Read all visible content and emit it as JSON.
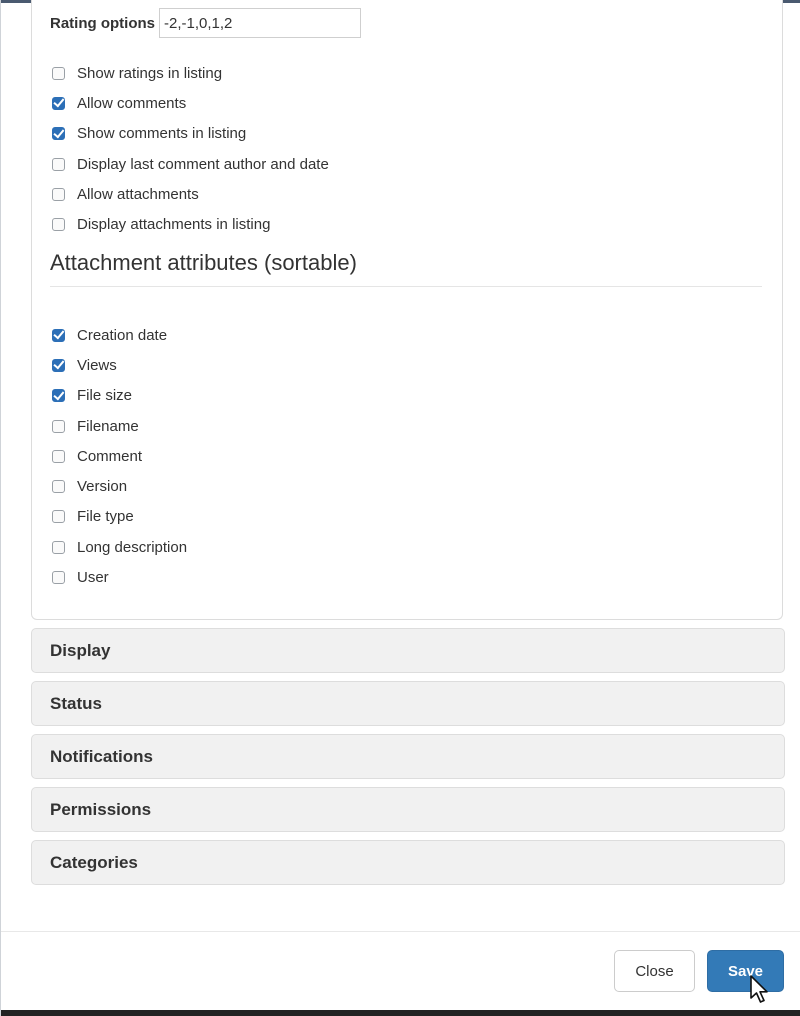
{
  "rating": {
    "label": "Rating options",
    "value": "-2,-1,0,1,2"
  },
  "general_options": [
    {
      "label": "Show ratings in listing",
      "checked": false
    },
    {
      "label": "Allow comments",
      "checked": true
    },
    {
      "label": "Show comments in listing",
      "checked": true
    },
    {
      "label": "Display last comment author and date",
      "checked": false
    },
    {
      "label": "Allow attachments",
      "checked": false
    },
    {
      "label": "Display attachments in listing",
      "checked": false
    }
  ],
  "attachment_section": {
    "heading": "Attachment attributes (sortable)",
    "attributes": [
      {
        "label": "Creation date",
        "checked": true
      },
      {
        "label": "Views",
        "checked": true
      },
      {
        "label": "File size",
        "checked": true
      },
      {
        "label": "Filename",
        "checked": false
      },
      {
        "label": "Comment",
        "checked": false
      },
      {
        "label": "Version",
        "checked": false
      },
      {
        "label": "File type",
        "checked": false
      },
      {
        "label": "Long description",
        "checked": false
      },
      {
        "label": "User",
        "checked": false
      }
    ]
  },
  "accordion": [
    {
      "label": "Display"
    },
    {
      "label": "Status"
    },
    {
      "label": "Notifications"
    },
    {
      "label": "Permissions"
    },
    {
      "label": "Categories"
    }
  ],
  "footer": {
    "close_label": "Close",
    "save_label": "Save"
  },
  "colors": {
    "checked": "#2c6fb7",
    "primary_button": "#337ab7",
    "accordion_bg": "#f1f1f1"
  },
  "icons": {
    "cursor": "mouse-pointer-icon"
  }
}
